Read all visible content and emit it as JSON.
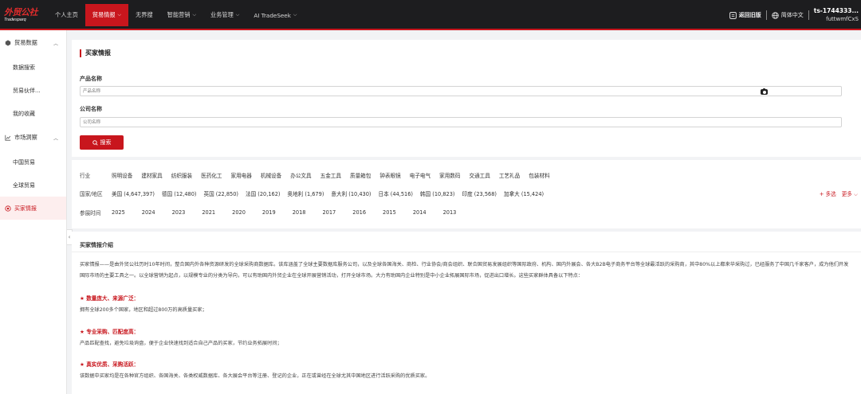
{
  "nav": {
    "logo": "Tradesparq",
    "logo_cn": "外贸公社",
    "items": [
      {
        "label": "个人主页",
        "chevron": false
      },
      {
        "label": "贸易情报",
        "chevron": true
      },
      {
        "label": "无界搜",
        "chevron": false
      },
      {
        "label": "智能营销",
        "chevron": true
      },
      {
        "label": "业务管理",
        "chevron": true
      },
      {
        "label": "AI TradeSeek",
        "chevron": true
      }
    ],
    "return_old": "返回旧版",
    "language": "简体中文",
    "user_line1": "ts-1744333...",
    "user_line2": "futtwmfCxS"
  },
  "sidebar": {
    "group1": "贸易数据",
    "group1_items": [
      "数据搜索",
      "贸易伙伴...",
      "我的收藏"
    ],
    "group2": "市场洞察",
    "group2_items": [
      "中国贸易",
      "全球贸易"
    ],
    "active_item": "买家情报"
  },
  "search": {
    "title": "买家情报",
    "product_label": "产品名称",
    "product_placeholder": "产品名称",
    "company_label": "公司名称",
    "company_placeholder": "公司名称",
    "button": "搜索"
  },
  "filters": {
    "industry_label": "行业",
    "industries": [
      "照明设备",
      "建材家具",
      "纺织服装",
      "医药化工",
      "家用电器",
      "机械设备",
      "办公文具",
      "五金工具",
      "质量箱包",
      "钟表眼镜",
      "电子电气",
      "家用数码",
      "交通工具",
      "工艺礼品",
      "包装材料"
    ],
    "country_label": "国家/地区",
    "countries": [
      "美国 (4,647,397)",
      "德国 (12,480)",
      "英国 (22,850)",
      "法国 (20,162)",
      "奥地利 (1,679)",
      "意大利 (10,430)",
      "日本 (44,516)",
      "韩国 (10,823)",
      "印度 (23,568)",
      "加拿大 (15,424)"
    ],
    "multi": "+ 多选",
    "more": "更多",
    "year_label": "参展时间",
    "years": [
      "2025",
      "2024",
      "2023",
      "2021",
      "2020",
      "2019",
      "2018",
      "2017",
      "2016",
      "2015",
      "2014",
      "2013"
    ]
  },
  "intro": {
    "title": "买家情报介绍",
    "paragraph": "买家情报——是由外贸公社历时10年时间，整合国内外各种资源研发的全球采购商数据库。该库涵盖了全球主要数据库服务公司，以及全球各国海关、商检、行业协会/商会组织、联合国贸易发展组织等国际政府、机构、国内外展会、各大B2B电子商务平台等全球最活跃的采购商，其中80%以上都来华采购过，已经服务了中国几千家客户，成为他们开发国际市场的主要工具之一。以全球营销为起点，以规模专业的分类为导向，可以有助国内外贸企业在全球开展营销活动，打开全球市场。大力有助国内企业特别是中小企业拓展国际市场，促进出口增长。这些买家群体具备以下特点：",
    "points": [
      {
        "title": "★ 数量庞大、来源广泛：",
        "desc": "拥有全球200多个国家，地区和超过800万的高质量买家；"
      },
      {
        "title": "★ 专业采购、匹配度高：",
        "desc": "产品匹配查找，避免垃圾询盘，便于企业快速找到适合自己产品的买家，节约业务拓展时间；"
      },
      {
        "title": "★ 真实优质、采购活跃：",
        "desc": "该数据中买家均是在各种官方组织、各国海关、各类权威数据库、各大展会平台等注册、登记的企业，正在或曾经在全球尤其中国地区进行活跃采购的优质买家。"
      }
    ]
  }
}
